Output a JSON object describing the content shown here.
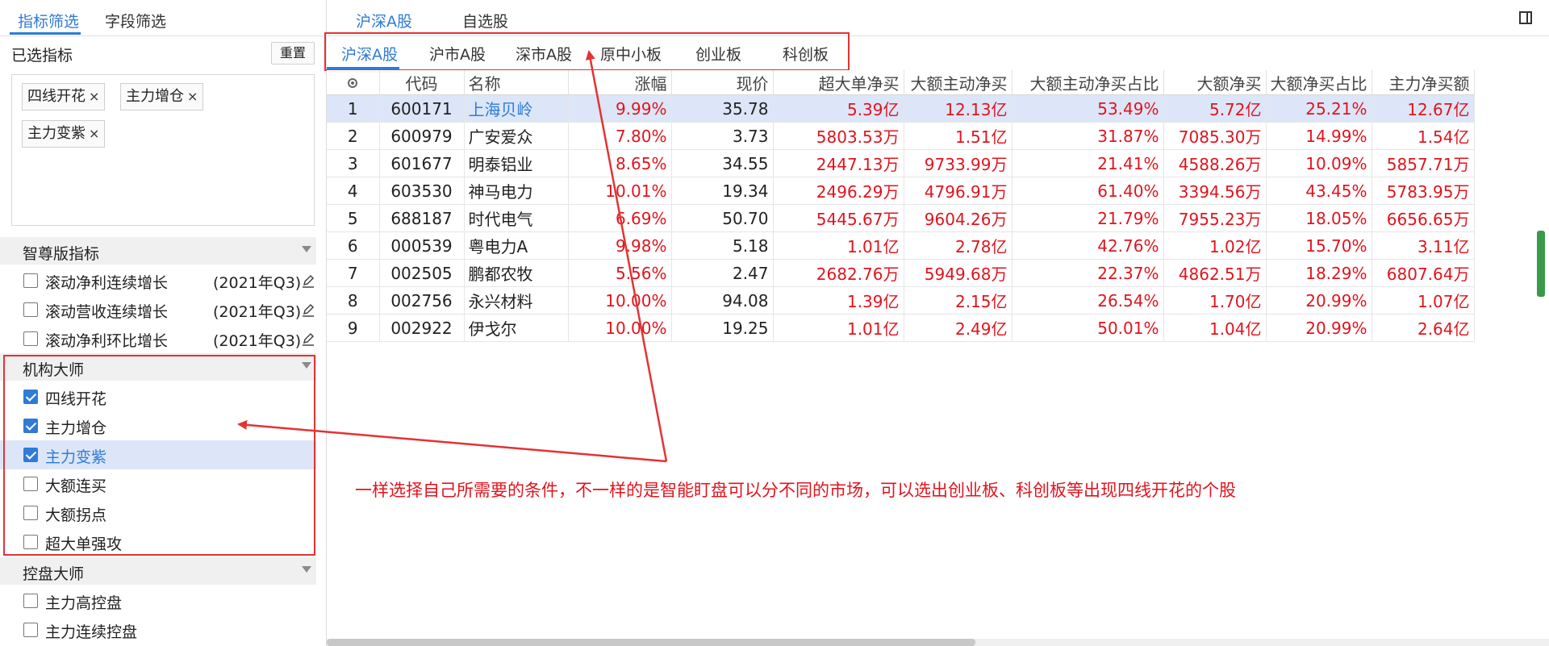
{
  "left_panel": {
    "tabs": [
      "指标筛选",
      "字段筛选"
    ],
    "selected_title": "已选指标",
    "reset_label": "重置",
    "chips": [
      "四线开花",
      "主力增仓",
      "主力变紫"
    ],
    "chip_close_glyph": "×",
    "sections": [
      {
        "title": "智尊版指标",
        "items": [
          {
            "label": "滚动净利连续增长",
            "period": "(2021年Q3)",
            "checked": false
          },
          {
            "label": "滚动营收连续增长",
            "period": "(2021年Q3)",
            "checked": false
          },
          {
            "label": "滚动净利环比增长",
            "period": "(2021年Q3)",
            "checked": false
          }
        ]
      },
      {
        "title": "机构大师",
        "items": [
          {
            "label": "四线开花",
            "checked": true
          },
          {
            "label": "主力增仓",
            "checked": true
          },
          {
            "label": "主力变紫",
            "checked": true,
            "highlighted": true
          },
          {
            "label": "大额连买",
            "checked": false
          },
          {
            "label": "大额拐点",
            "checked": false
          },
          {
            "label": "超大单强攻",
            "checked": false
          }
        ]
      },
      {
        "title": "控盘大师",
        "items": [
          {
            "label": "主力高控盘",
            "checked": false
          },
          {
            "label": "主力连续控盘",
            "checked": false
          }
        ]
      }
    ]
  },
  "main": {
    "top_tabs": [
      "沪深A股",
      "自选股"
    ],
    "sub_tabs": [
      "沪深A股",
      "沪市A股",
      "深市A股",
      "原中小板",
      "创业板",
      "科创板"
    ],
    "columns": [
      "代码",
      "名称",
      "涨幅",
      "现价",
      "超大单净买",
      "大额主动净买",
      "大额主动净买占比",
      "大额净买",
      "大额净买占比",
      "主力净买额"
    ],
    "rows": [
      [
        "1",
        "600171",
        "上海贝岭",
        "9.99%",
        "35.78",
        "5.39亿",
        "12.13亿",
        "53.49%",
        "5.72亿",
        "25.21%",
        "12.67亿"
      ],
      [
        "2",
        "600979",
        "广安爱众",
        "7.80%",
        "3.73",
        "5803.53万",
        "1.51亿",
        "31.87%",
        "7085.30万",
        "14.99%",
        "1.54亿"
      ],
      [
        "3",
        "601677",
        "明泰铝业",
        "8.65%",
        "34.55",
        "2447.13万",
        "9733.99万",
        "21.41%",
        "4588.26万",
        "10.09%",
        "5857.71万"
      ],
      [
        "4",
        "603530",
        "神马电力",
        "10.01%",
        "19.34",
        "2496.29万",
        "4796.91万",
        "61.40%",
        "3394.56万",
        "43.45%",
        "5783.95万"
      ],
      [
        "5",
        "688187",
        "时代电气",
        "6.69%",
        "50.70",
        "5445.67万",
        "9604.26万",
        "21.79%",
        "7955.23万",
        "18.05%",
        "6656.65万"
      ],
      [
        "6",
        "000539",
        "粤电力A",
        "9.98%",
        "5.18",
        "1.01亿",
        "2.78亿",
        "42.76%",
        "1.02亿",
        "15.70%",
        "3.11亿"
      ],
      [
        "7",
        "002505",
        "鹏都农牧",
        "5.56%",
        "2.47",
        "2682.76万",
        "5949.68万",
        "22.37%",
        "4862.51万",
        "18.29%",
        "6807.64万"
      ],
      [
        "8",
        "002756",
        "永兴材料",
        "10.00%",
        "94.08",
        "1.39亿",
        "2.15亿",
        "26.54%",
        "1.70亿",
        "20.99%",
        "1.07亿"
      ],
      [
        "9",
        "002922",
        "伊戈尔",
        "10.00%",
        "19.25",
        "1.01亿",
        "2.49亿",
        "50.01%",
        "1.04亿",
        "20.99%",
        "2.64亿"
      ]
    ],
    "selected_row": 0
  },
  "annotation": "一样选择自己所需要的条件，不一样的是智能盯盘可以分不同的市场，可以选出创业板、科创板等出现四线开花的个股",
  "colors": {
    "accent": "#2f7bd6",
    "up": "#e0141e",
    "annotation": "#e33333",
    "row_highlight": "#dce6f8"
  },
  "icons": [
    "close-icon",
    "checkbox-icon",
    "edit-pencil-icon",
    "collapse-arrow-icon",
    "column-settings-icon",
    "layout-toggle-icon"
  ]
}
